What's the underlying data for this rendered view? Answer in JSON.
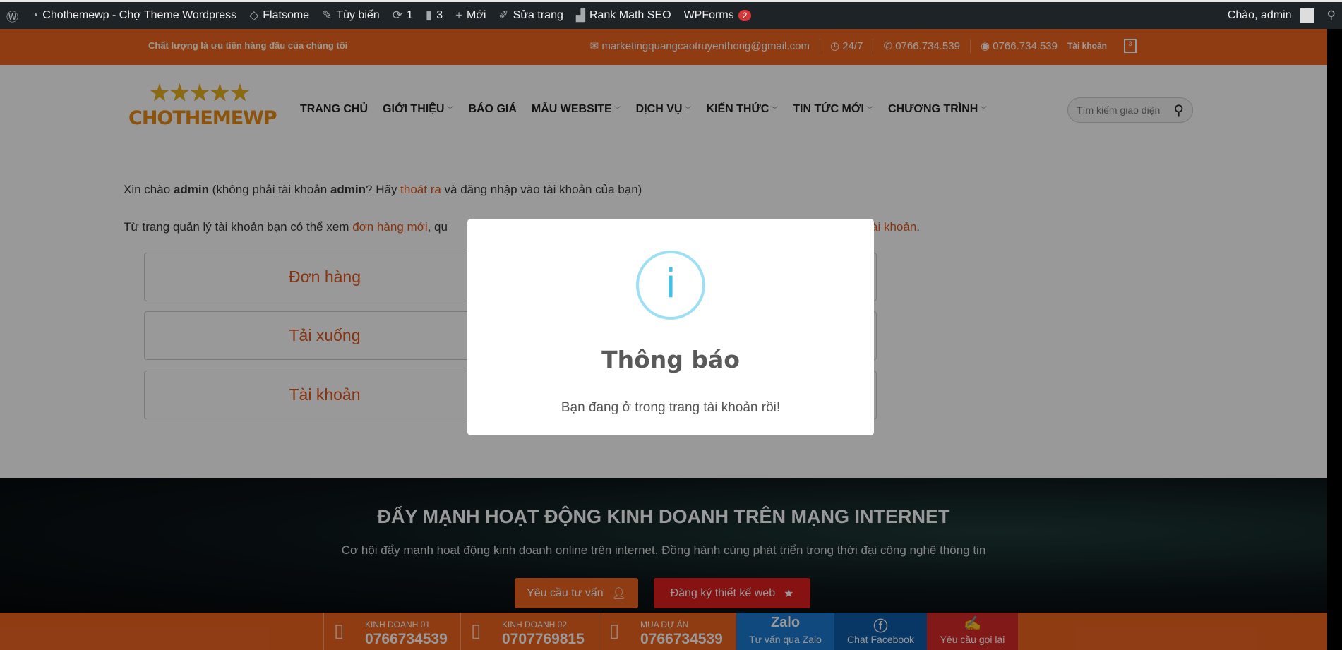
{
  "admin_bar": {
    "site": "Chothemewp - Chợ Theme Wordpress",
    "theme": "Flatsome",
    "customize": "Tùy biến",
    "updates": "1",
    "comments": "3",
    "new": "Mới",
    "edit": "Sửa trang",
    "rankmath": "Rank Math SEO",
    "wpforms": "WPForms",
    "wpforms_badge": "2",
    "greeting": "Chào, admin"
  },
  "topbar": {
    "tagline": "Chất lượng là ưu tiên hàng đầu của chúng tôi",
    "email": "marketingquangcaotruyenthong@gmail.com",
    "hours": "24/7",
    "phone": "0766.734.539",
    "whatsapp": "0766.734.539",
    "account": "Tài khoản",
    "cart_count": "3"
  },
  "logo": {
    "text": "CHOTHEMEWP"
  },
  "nav": [
    {
      "label": "TRANG CHỦ",
      "dropdown": false
    },
    {
      "label": "GIỚI THIỆU",
      "dropdown": true
    },
    {
      "label": "BÁO GIÁ",
      "dropdown": false
    },
    {
      "label": "MẪU WEBSITE",
      "dropdown": true
    },
    {
      "label": "DỊCH VỤ",
      "dropdown": true
    },
    {
      "label": "KIẾN THỨC",
      "dropdown": true
    },
    {
      "label": "TIN TỨC MỚI",
      "dropdown": true
    },
    {
      "label": "CHƯƠNG TRÌNH",
      "dropdown": true
    }
  ],
  "search": {
    "placeholder": "Tìm kiếm giao diện"
  },
  "content": {
    "hello_1": "Xin chào ",
    "user": "admin",
    "hello_2": " (không phải tài khoản ",
    "hello_3": "? Hãy ",
    "logout": "thoát ra",
    "hello_4": " và đăng nhập vào tài khoản của bạn)",
    "desc_1": "Từ trang quản lý tài khoản bạn có thể xem ",
    "orders_link": "đơn hàng mới",
    "desc_2": ", qu",
    "account_link": "ài khoản",
    "desc_end": ".",
    "boxes": [
      "Đơn hàng",
      "Tải xuống",
      "Tài khoản"
    ]
  },
  "banner": {
    "title": "ĐẨY MẠNH HOẠT ĐỘNG KINH DOANH TRÊN MẠNG INTERNET",
    "subtitle": "Cơ hội đẩy mạnh hoạt động kinh doanh online trên internet. Đồng hành cùng phát triển trong thời đại công nghệ thông tin",
    "btn_consult": "Yêu cầu tư vấn",
    "btn_register": "Đăng ký thiết kế web"
  },
  "bottom_bar": {
    "contacts": [
      {
        "label": "KINH DOANH 01",
        "number": "0766734539"
      },
      {
        "label": "KINH DOANH 02",
        "number": "0707769815"
      },
      {
        "label": "MUA DỰ ÁN",
        "number": "0766734539"
      }
    ],
    "zalo": "Tư vấn qua Zalo",
    "zalo_logo": "Zalo",
    "facebook": "Chat Facebook",
    "callback": "Yêu cầu gọi lại"
  },
  "modal": {
    "icon": "i",
    "title": "Thông báo",
    "message": "Bạn đang ở trong trang tài khoản rồi!"
  },
  "colors": {
    "brand": "#f06421",
    "admin_bar": "#1d2327",
    "info": "#3fc3ee",
    "zalo": "#1c7bd1",
    "facebook": "#0e5aa8",
    "callback": "#d82a2a"
  }
}
